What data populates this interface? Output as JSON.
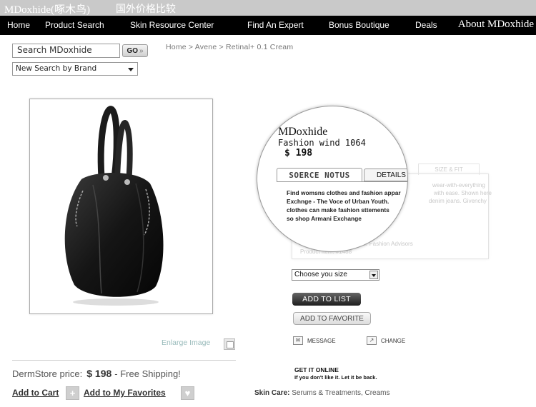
{
  "header": {
    "brand": "MDoxhide(啄木鸟)",
    "subtitle": "国外价格比较"
  },
  "nav": {
    "items": [
      "Home",
      "Product Search",
      "Skin Resource Center",
      "Find An Expert",
      "Bonus Boutique",
      "Deals"
    ],
    "about": "About MDoxhide"
  },
  "search": {
    "value": "Search MDoxhide",
    "go_label": "GO",
    "go_arrow": "»",
    "brand_select": "New Search by Brand"
  },
  "breadcrumb": "Home > Avene > Retinal+ 0.1 Cream",
  "product": {
    "enlarge_label": "Enlarge Image",
    "price_label": "DermStore price:",
    "price": "$ 198",
    "shipping": "- Free Shipping!",
    "add_to_cart": "Add to Cart",
    "add_to_favorites": "Add to My Favorites"
  },
  "magnifier": {
    "title": "MDoxhide",
    "subtitle": "Fashion wind 1064",
    "price": "$ 198",
    "tab_active": "SOERCE NOTUS",
    "tab_details": "DETAILS",
    "description": [
      "Find womsns clothes and fashion appar",
      "Exchnge - The Voce of Urban Youth.",
      " clothes can make fashion sttements",
      "so shop Armani Exchange"
    ]
  },
  "background_panel": {
    "tab_label": "SIZE & FIT",
    "lines": [
      "wear-with-everything",
      "with ease. Shown here",
      "denim jeans. Givenchy"
    ],
    "advisors": "our Fashion Advisors",
    "product_line": "Product Item: #1488"
  },
  "options": {
    "size_select": "Choose you  size",
    "add_to_list": "ADD TO LIST",
    "add_to_favorite": "ADD TO FAVORITE",
    "message": "MESSAGE",
    "change": "CHANGE"
  },
  "footer": {
    "get_online": "GET IT ONLINE",
    "get_online_sub": "If you don't like it. Let it be back.",
    "skin_care_label": "Skin Care:",
    "skin_care_links": "Serums & Treatments, Creams"
  }
}
